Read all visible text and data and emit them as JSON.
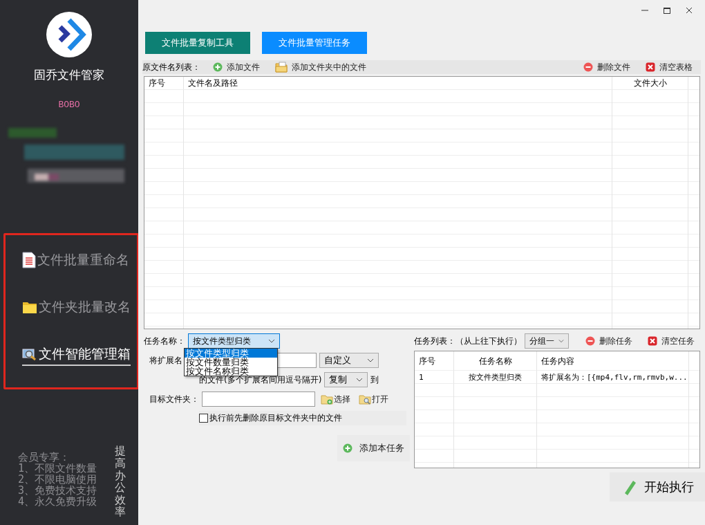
{
  "sidebar": {
    "app_name": "固乔文件管家",
    "user": "BOBO",
    "nav": [
      {
        "label": "文件批量重命名",
        "selected": false
      },
      {
        "label": "文件夹批量改名",
        "selected": false
      },
      {
        "label": "文件智能管理箱",
        "selected": true
      }
    ],
    "member_title": "会员专享：",
    "member_perks": [
      "1、不限文件数量",
      "2、不限电脑使用",
      "3、免费技术支持",
      "4、永久免费升级"
    ],
    "slogan": "提高办公效率"
  },
  "tabs": [
    {
      "label": "文件批量复制工具",
      "selected": false
    },
    {
      "label": "文件批量管理任务",
      "selected": true
    }
  ],
  "file_toolbar": {
    "label": "原文件名列表：",
    "actions": [
      {
        "label": "添加文件"
      },
      {
        "label": "添加文件夹中的文件"
      },
      {
        "label": "删除文件"
      },
      {
        "label": "清空表格"
      }
    ]
  },
  "file_table": {
    "columns": [
      "序号",
      "文件名及路径",
      "文件大小"
    ]
  },
  "task_form": {
    "task_name_label": "任务名称：",
    "task_name_value": "按文件类型归类",
    "task_name_options": [
      {
        "label": "按文件类型归类",
        "selected": true
      },
      {
        "label": "按文件数量归类",
        "selected": false
      },
      {
        "label": "按文件名称归类",
        "selected": false
      }
    ],
    "ext_label": "将扩展名",
    "ext_mode": "自定义",
    "files_label": "的文件(多个扩展名间用逗号隔开)",
    "action": "复制",
    "to_label": "到",
    "target_label": "目标文件夹：",
    "choose_button": "选择",
    "open_button": "打开",
    "delete_first": {
      "label": "执行前先删除原目标文件夹中的文件",
      "checked": false
    },
    "add_button": "添加本任务"
  },
  "task_list": {
    "label": "任务列表：（从上往下执行）",
    "group": "分组一",
    "delete_button": "删除任务",
    "clear_button": "清空任务",
    "columns": [
      "序号",
      "任务名称",
      "任务内容"
    ],
    "rows": [
      [
        "1",
        "按文件类型归类",
        "将扩展名为：[{mp4,flv,rm,rmvb,w..."
      ]
    ]
  },
  "start_button": "开始执行"
}
